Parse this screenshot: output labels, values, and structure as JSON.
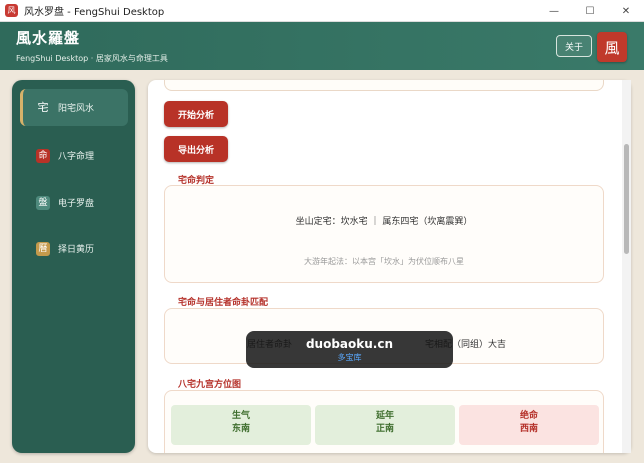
{
  "window": {
    "title": "风水罗盘 - FengShui Desktop",
    "icon_glyph": "风",
    "minimize": "—",
    "maximize": "☐",
    "close": "✕"
  },
  "header": {
    "title": "風水羅盤",
    "subtitle": "FengShui Desktop · 居家风水与命理工具",
    "about_label": "关于",
    "logo_glyph": "風"
  },
  "sidebar": {
    "items": [
      {
        "icon": "宅",
        "label": "阳宅风水",
        "active": true
      },
      {
        "icon": "命",
        "label": "八字命理",
        "active": false
      },
      {
        "icon": "盤",
        "label": "电子罗盘",
        "active": false
      },
      {
        "icon": "曆",
        "label": "择日黄历",
        "active": false
      }
    ]
  },
  "main": {
    "start_button": "开始分析",
    "export_button": "导出分析",
    "house_section": {
      "title": "宅命判定",
      "result": "坐山定宅：坎水宅  ｜  属东四宅（坎离震巽）",
      "note": "大游年起法：以本宫「坎水」为伏位顺布八星"
    },
    "match_section": {
      "title": "宅命与居住者命卦匹配",
      "row_left": "居住者命卦",
      "row_right": "宅相配（同组）大吉"
    },
    "nine_palace": {
      "title": "八宅九宫方位图",
      "cells": [
        {
          "star": "生气",
          "direction": "东南"
        },
        {
          "star": "延年",
          "direction": "正南"
        },
        {
          "star": "绝命",
          "direction": "西南"
        }
      ]
    }
  },
  "watermark": {
    "main": "duobaoku.cn",
    "sub": "多宝库"
  },
  "colors": {
    "header": "#2f6a5b",
    "sidebar": "#2a5e51",
    "accent_red": "#b83227",
    "gold": "#d6b26a"
  }
}
